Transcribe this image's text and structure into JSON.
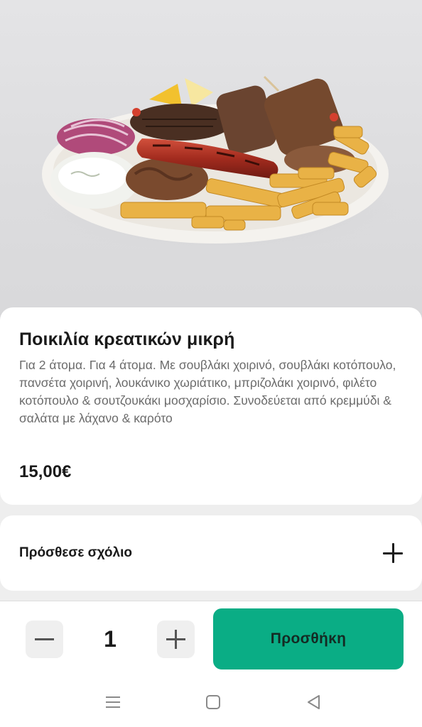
{
  "product": {
    "title": "Ποικιλία κρεατικών μικρή",
    "description": "Για 2 άτομα. Για 4 άτομα. Με σουβλάκι χοιρινό, σουβλάκι κοτόπουλο, πανσέτα χοιρινή, λουκάνικο χωριάτικο, μπριζολάκι χοιρινό, φιλέτο κοτόπουλο & σουτζουκάκι μοσχαρίσιο. Συνοδεύεται από κρεμμύδι & σαλάτα με λάχανο & καρότο",
    "price": "15,00€",
    "image_icon": "food-platter-image"
  },
  "comment": {
    "label": "Πρόσθεσε σχόλιο",
    "icon": "plus-icon"
  },
  "cart": {
    "quantity": "1",
    "decrement_icon": "minus-icon",
    "increment_icon": "plus-icon",
    "add_label": "Προσθήκη"
  },
  "navbar": {
    "icons": [
      "menu-icon",
      "home-icon",
      "back-icon"
    ]
  },
  "colors": {
    "accent": "#0aad85",
    "card": "#ffffff",
    "background": "#eeeeee",
    "muted_text": "#6b6b6b"
  }
}
